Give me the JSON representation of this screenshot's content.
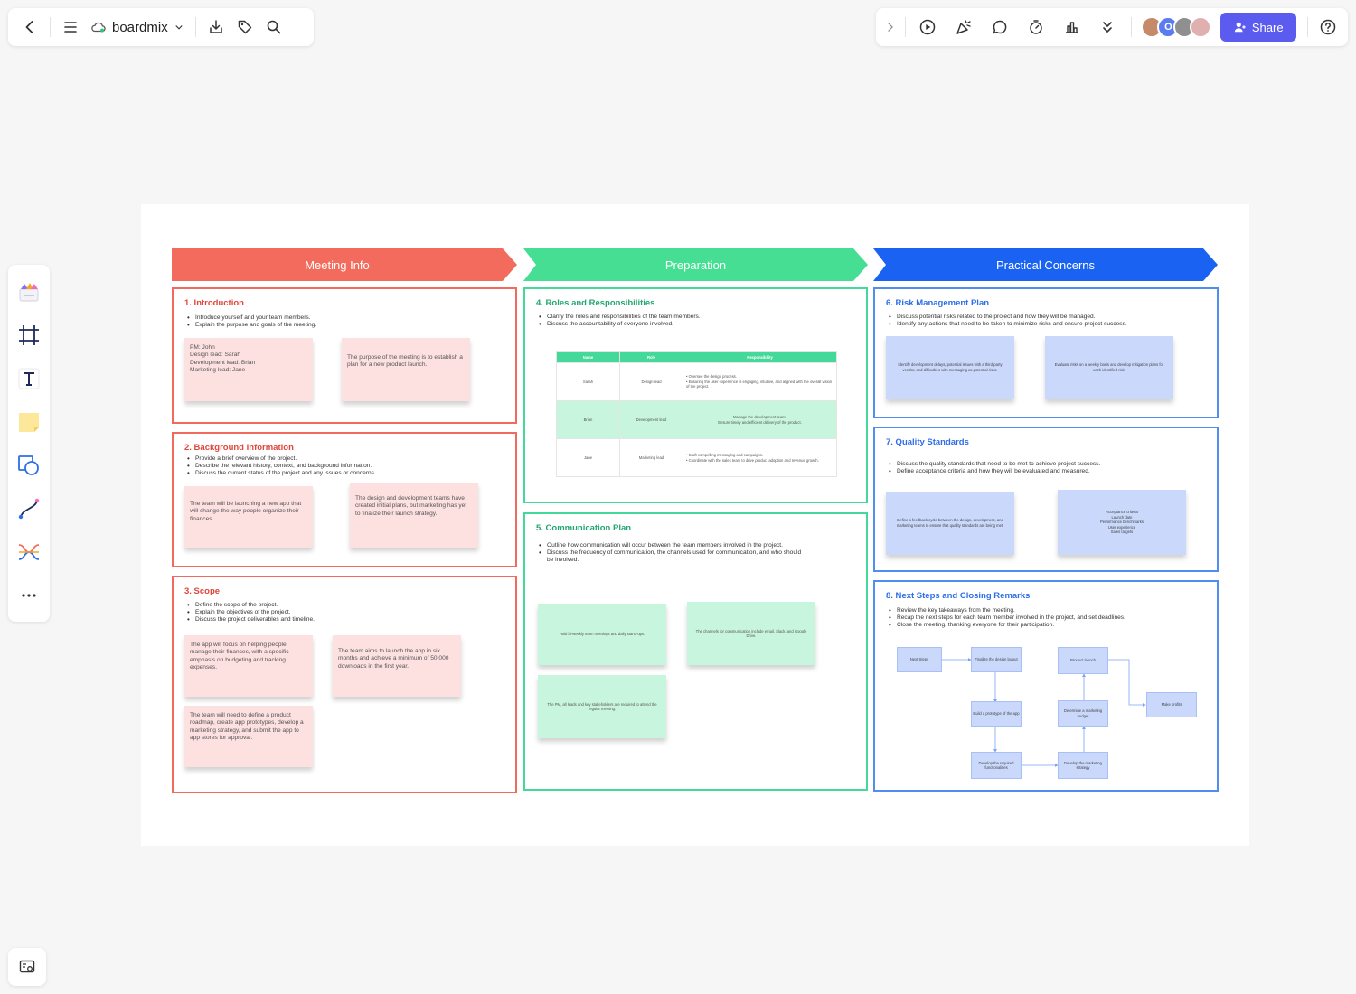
{
  "toolbar": {
    "brand": "boardmix",
    "share_label": "Share",
    "avatars": [
      {
        "label": "",
        "color": "#c48a6a"
      },
      {
        "label": "O",
        "color": "#5b7cf0"
      },
      {
        "label": "",
        "color": "#8f8f8f"
      },
      {
        "label": "",
        "color": "#e0b0b0"
      }
    ]
  },
  "board": {
    "banners": [
      {
        "label": "Meeting Info",
        "color": "#f36b5d"
      },
      {
        "label": "Preparation",
        "color": "#45de93"
      },
      {
        "label": "Practical Concerns",
        "color": "#1a63f2"
      }
    ],
    "introduction": {
      "title": "1.  Introduction",
      "bullets": [
        "Introduce yourself and your team members.",
        "Explain the purpose and goals of the meeting."
      ],
      "notes": [
        "PM: John\nDesign lead: Sarah\nDevelopment lead: Brian\nMarketing lead: Jane",
        "The purpose of the meeting is to establish a plan for a new product launch."
      ]
    },
    "background": {
      "title": "2.  Background Information",
      "bullets": [
        "Provide a brief overview of the project.",
        "Describe the relevant history, context, and background information.",
        "Discuss the current status of the project and any issues or concerns."
      ],
      "notes": [
        "The team will be launching a new app that will change the way people organize their finances.",
        "The design and development teams have created initial plans, but marketing has yet to finalize their launch strategy."
      ]
    },
    "scope": {
      "title": "3.  Scope",
      "bullets": [
        "Define the scope of the project.",
        "Explain the objectives of the project.",
        "Discuss the project deliverables and timeline."
      ],
      "notes": [
        "The app will focus on helping people manage their finances, with a specific emphasis on budgeting and tracking expenses.",
        "The team aims to launch the app in six months and achieve a minimum of 50,000 downloads in the first year.",
        "The team will need to define a product roadmap, create app prototypes, develop a marketing strategy, and submit the app to app stores for approval."
      ]
    },
    "roles": {
      "title": "4.  Roles and Responsibilities",
      "bullets": [
        "Clarify the roles and responsibilities of the team members.",
        "Discuss the accountability of everyone involved."
      ],
      "table": {
        "headers": [
          "Name",
          "Role",
          "Responsibility"
        ],
        "rows": [
          {
            "name": "Sarah",
            "role": "Design lead",
            "resp": [
              "Oversee the design process.",
              "Ensuring the user experience is engaging, intuitive, and aligned with the overall vision of the project."
            ]
          },
          {
            "name": "Brian",
            "role": "Development lead",
            "resp": [
              "Manage the development team.",
              "Ensure timely and efficient delivery of the product."
            ]
          },
          {
            "name": "Jane",
            "role": "Marketing lead",
            "resp": [
              "Craft compelling messaging and campaigns.",
              "Coordinate with the sales team to drive product adoption and revenue growth."
            ]
          }
        ]
      }
    },
    "communication": {
      "title": "5.  Communication Plan",
      "bullets": [
        "Outline how communication will occur between the team members involved in the project.",
        "Discuss the frequency of communication, the channels used for communication, and who should be involved."
      ],
      "notes": [
        "Hold bi-weekly team meetings and daily stand-ups.",
        "The channels for communication include email, Slack, and Google Drive.",
        "The PM, all leads and key stakeholders are required to attend the regular meeting."
      ]
    },
    "risk": {
      "title": "6.  Risk Management Plan",
      "bullets": [
        "Discuss potential risks related to the project and how they will be managed.",
        "Identify any actions that need to be taken to minimize risks and ensure project success."
      ],
      "notes": [
        "Identify development delays, potential issues with a third-party vendor, and difficulties with messaging as potential risks.",
        "Evaluate risks on a weekly basis and develop mitigation plans for each identified risk."
      ]
    },
    "quality": {
      "title": "7.  Quality Standards",
      "bullets": [
        "Discuss the quality standards that need to be met to achieve project success.",
        "Define acceptance criteria and how they will be evaluated and measured."
      ],
      "notes": [
        "Define a feedback cycle between the design, development, and marketing teams to ensure that quality standards are being met.",
        "Acceptance criteria\nLaunch date\nPerformance benchmarks\nUser experience\nSales targets"
      ]
    },
    "next_steps": {
      "title": "8.  Next Steps and Closing Remarks",
      "bullets": [
        "Review the key takeaways from the meeting.",
        "Recap the next steps for each team member involved in the project, and set deadlines.",
        "Close the meeting, thanking everyone for their participation."
      ],
      "flow": [
        "Next Steps",
        "Finalize the design layout",
        "Build a prototype of the app",
        "Develop the required functionalities",
        "Product launch",
        "Determine a marketing budget",
        "Develop the marketing strategy",
        "Make profits"
      ]
    }
  }
}
